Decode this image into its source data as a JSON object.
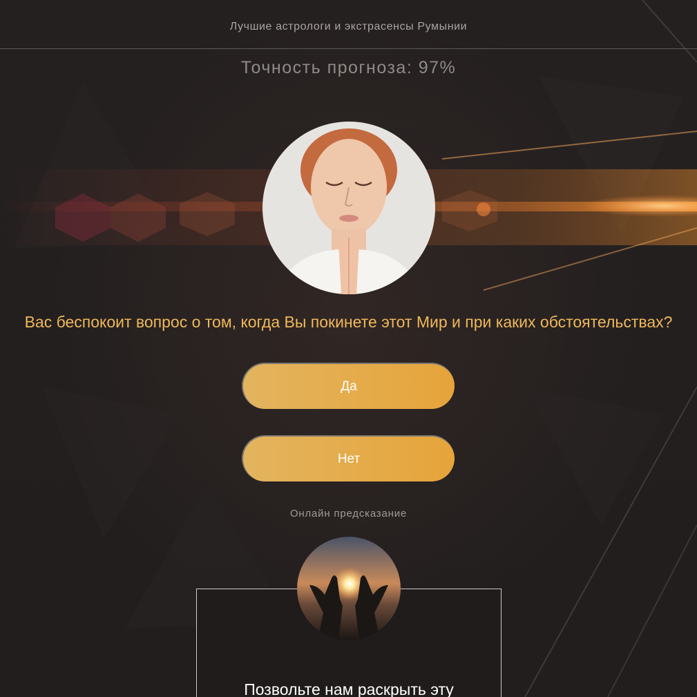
{
  "header": {
    "title": "Лучшие астрологи и экстрасенсы Румынии"
  },
  "accuracy_text": "Точность прогноза: 97%",
  "question": "Вас беспокоит вопрос о том, когда Вы покинете этот Мир и при каких обстоятельствах?",
  "buttons": {
    "yes_label": "Да",
    "no_label": "Нет"
  },
  "online_label": "Онлайн предсказание",
  "card": {
    "text": "Позвольте нам раскрыть эту"
  },
  "colors": {
    "background": "#231f1f",
    "accent_text": "#f0b85a",
    "button_gradient_start": "#e3b45f",
    "button_gradient_end": "#e6a43a"
  }
}
